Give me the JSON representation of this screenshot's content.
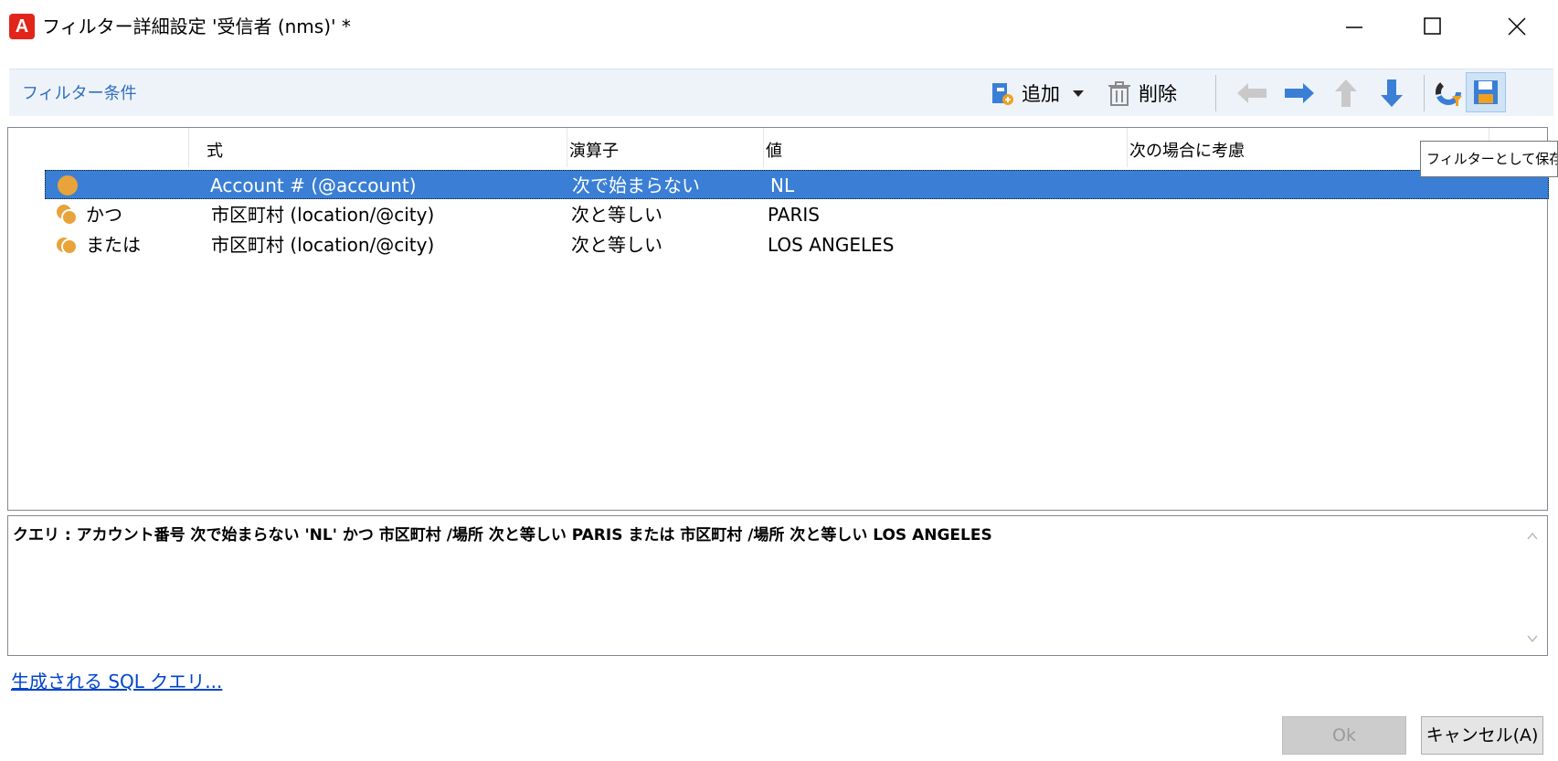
{
  "window": {
    "title": "フィルター詳細設定 '受信者 (nms)' *",
    "app_icon_letter": "A"
  },
  "toolbar": {
    "section_label": "フィルター条件",
    "add_label": "追加",
    "delete_label": "削除"
  },
  "tooltip": "フィルターとして保存",
  "grid": {
    "columns": [
      "式",
      "演算子",
      "値",
      "次の場合に考慮"
    ],
    "rows": [
      {
        "logic": "",
        "expression": "Account # (@account)",
        "operator": "次で始まらない",
        "value": "NL",
        "consider": ""
      },
      {
        "logic": "かつ",
        "expression": "市区町村 (location/@city)",
        "operator": "次と等しい",
        "value": "PARIS",
        "consider": ""
      },
      {
        "logic": "または",
        "expression": "市区町村 (location/@city)",
        "operator": "次と等しい",
        "value": "LOS ANGELES",
        "consider": ""
      }
    ],
    "selected_row": 0
  },
  "query": {
    "text": "クエリ : アカウント番号 次で始まらない 'NL' かつ 市区町村 /場所 次と等しい PARIS または 市区町村 /場所 次と等しい LOS ANGELES"
  },
  "sql_link": "生成される SQL クエリ...",
  "buttons": {
    "ok": "Ok",
    "cancel": "キャンセル(A)"
  },
  "colors": {
    "selection": "#3a7fd5",
    "condition_icon": "#e8a33a",
    "arrow_blue": "#3a7fd5",
    "arrow_disabled": "#c9c9c9",
    "link": "#0044cc"
  }
}
